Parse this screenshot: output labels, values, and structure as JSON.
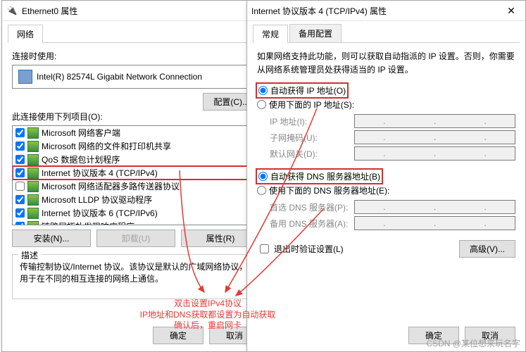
{
  "back": {
    "title": "Ethernet0 属性",
    "tab": "网络",
    "connect_using": "连接时使用:",
    "adapter": "Intel(R) 82574L Gigabit Network Connection",
    "configure": "配置(C)...",
    "uses_items": "此连接使用下列项目(O):",
    "items": [
      {
        "checked": true,
        "label": "Microsoft 网络客户端"
      },
      {
        "checked": true,
        "label": "Microsoft 网络的文件和打印机共享"
      },
      {
        "checked": true,
        "label": "QoS 数据包计划程序"
      },
      {
        "checked": true,
        "label": "Internet 协议版本 4 (TCP/IPv4)",
        "hl": true
      },
      {
        "checked": false,
        "label": "Microsoft 网络适配器多路传送器协议"
      },
      {
        "checked": true,
        "label": "Microsoft LLDP 协议驱动程序"
      },
      {
        "checked": true,
        "label": "Internet 协议版本 6 (TCP/IPv6)"
      },
      {
        "checked": true,
        "label": "链路层拓扑发现响应程序"
      }
    ],
    "install": "安装(N)...",
    "uninstall": "卸载(U)",
    "properties": "属性(R)",
    "desc_title": "描述",
    "desc": "传输控制协议/Internet 协议。该协议是默认的广域网络协议，用于在不同的相互连接的网络上通信。",
    "ok": "确定",
    "cancel": "取消"
  },
  "front": {
    "title": "Internet 协议版本 4 (TCP/IPv4) 属性",
    "tab1": "常规",
    "tab2": "备用配置",
    "info": "如果网络支持此功能，则可以获取自动指派的 IP 设置。否则，你需要从网络系统管理员处获得适当的 IP 设置。",
    "auto_ip": "自动获得 IP 地址(O)",
    "manual_ip": "使用下面的 IP 地址(S):",
    "ip": "IP 地址(I):",
    "mask": "子网掩码(U):",
    "gw": "默认网关(D):",
    "auto_dns": "自动获得 DNS 服务器地址(B)",
    "manual_dns": "使用下面的 DNS 服务器地址(E):",
    "dns1": "首选 DNS 服务器(P):",
    "dns2": "备用 DNS 服务器(A):",
    "validate": "退出时验证设置(L)",
    "advanced": "高级(V)...",
    "ok": "确定",
    "cancel": "取消"
  },
  "annot": {
    "l1": "双击设置IPv4协议",
    "l2": "IP地址和DNS获取都设置为自动获取",
    "l3": "确认后，重启网卡"
  },
  "watermark": "CSDN @某位想来玩名字"
}
